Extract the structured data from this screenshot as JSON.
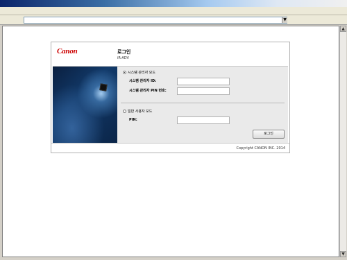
{
  "browser": {
    "address_value": "",
    "dropdown_glyph": "▼",
    "scroll_up_glyph": "▲",
    "scroll_down_glyph": "▼"
  },
  "header": {
    "logo": "Canon",
    "title": "로그인",
    "device": "iR-ADV"
  },
  "form": {
    "admin_mode_label": "시스템 관리자 모드",
    "admin_id_label": "시스템 관리자 ID:",
    "admin_pin_label": "시스템 관리자 PIN 번호:",
    "general_mode_label": "일반 사용자 모드",
    "pin_label": "PIN:",
    "admin_id_value": "",
    "admin_pin_value": "",
    "pin_value": "",
    "selected_mode": "admin"
  },
  "actions": {
    "login_label": "로그인"
  },
  "footer": {
    "copyright": "Copyright CANON INC. 2014"
  },
  "colors": {
    "logo_red": "#cc0000",
    "form_bg": "#eaeaea"
  }
}
